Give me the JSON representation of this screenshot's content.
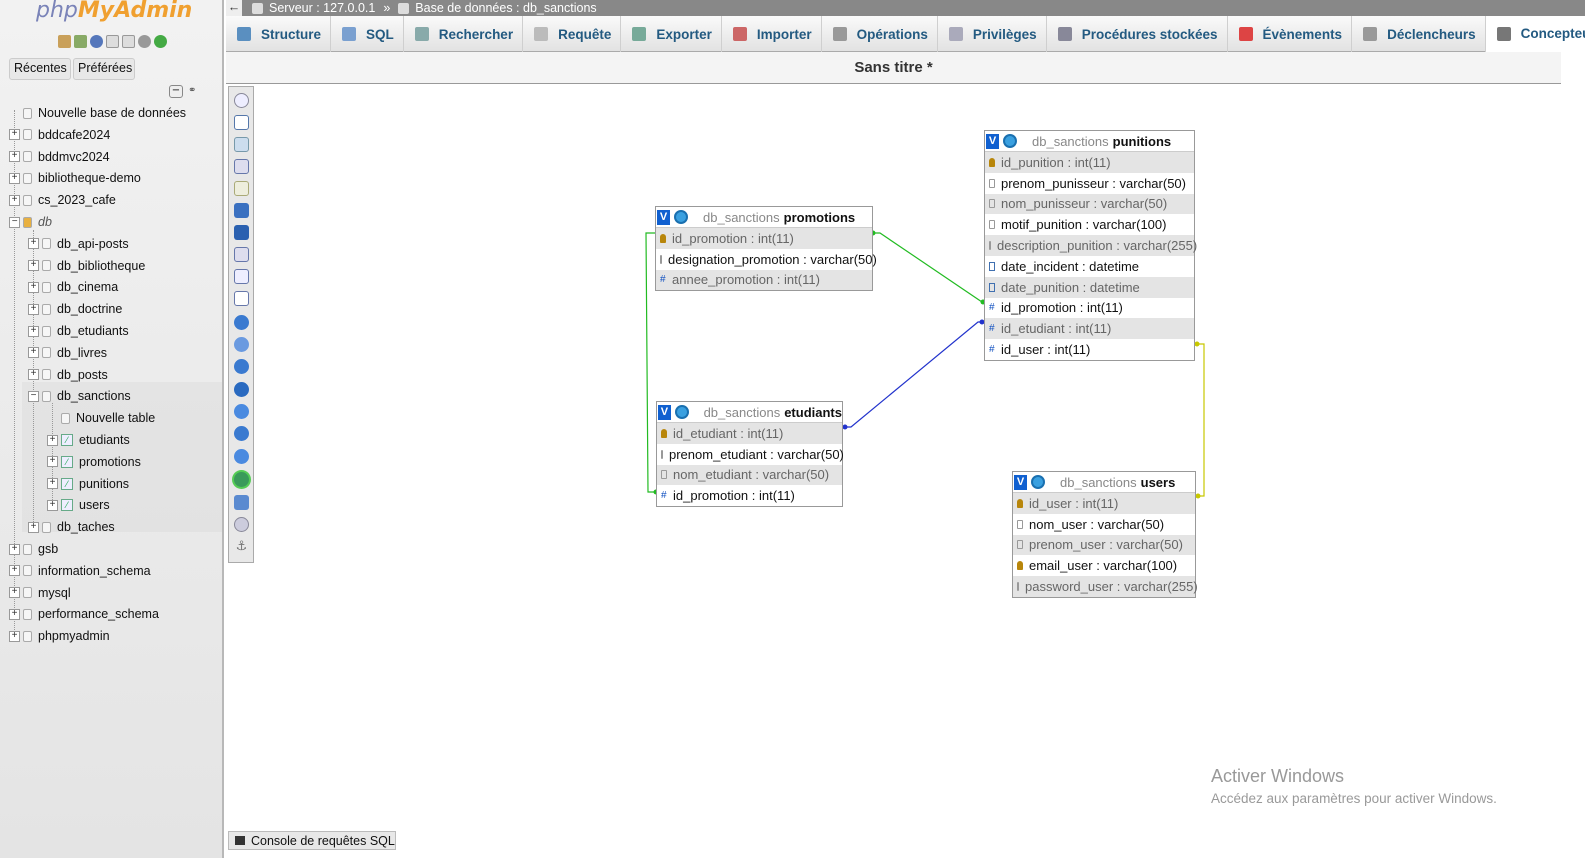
{
  "nav": {
    "logo_main": "php",
    "logo_accent": "MyAdmin",
    "tabs": [
      "Récentes",
      "Préférées"
    ],
    "tree": [
      {
        "label": "Nouvelle base de données",
        "level": 0,
        "expander": "",
        "icon": "new-db"
      },
      {
        "label": "bddcafe2024",
        "level": 0,
        "expander": "+",
        "icon": "db"
      },
      {
        "label": "bddmvc2024",
        "level": 0,
        "expander": "+",
        "icon": "db"
      },
      {
        "label": "bibliotheque-demo",
        "level": 0,
        "expander": "+",
        "icon": "db"
      },
      {
        "label": "cs_2023_cafe",
        "level": 0,
        "expander": "+",
        "icon": "db"
      },
      {
        "label": "db",
        "level": 0,
        "expander": "−",
        "icon": "db-group",
        "italic": true
      },
      {
        "label": "db_api-posts",
        "level": 1,
        "expander": "+",
        "icon": "db"
      },
      {
        "label": "db_bibliotheque",
        "level": 1,
        "expander": "+",
        "icon": "db"
      },
      {
        "label": "db_cinema",
        "level": 1,
        "expander": "+",
        "icon": "db"
      },
      {
        "label": "db_doctrine",
        "level": 1,
        "expander": "+",
        "icon": "db"
      },
      {
        "label": "db_etudiants",
        "level": 1,
        "expander": "+",
        "icon": "db"
      },
      {
        "label": "db_livres",
        "level": 1,
        "expander": "+",
        "icon": "db"
      },
      {
        "label": "db_posts",
        "level": 1,
        "expander": "+",
        "icon": "db"
      },
      {
        "label": "db_sanctions",
        "level": 1,
        "expander": "−",
        "icon": "db"
      },
      {
        "label": "Nouvelle table",
        "level": 2,
        "expander": "",
        "icon": "new-table"
      },
      {
        "label": "etudiants",
        "level": 2,
        "expander": "+",
        "icon": "table"
      },
      {
        "label": "promotions",
        "level": 2,
        "expander": "+",
        "icon": "table"
      },
      {
        "label": "punitions",
        "level": 2,
        "expander": "+",
        "icon": "table"
      },
      {
        "label": "users",
        "level": 2,
        "expander": "+",
        "icon": "table"
      },
      {
        "label": "db_taches",
        "level": 1,
        "expander": "+",
        "icon": "db"
      },
      {
        "label": "gsb",
        "level": 0,
        "expander": "+",
        "icon": "db"
      },
      {
        "label": "information_schema",
        "level": 0,
        "expander": "+",
        "icon": "db"
      },
      {
        "label": "mysql",
        "level": 0,
        "expander": "+",
        "icon": "db"
      },
      {
        "label": "performance_schema",
        "level": 0,
        "expander": "+",
        "icon": "db"
      },
      {
        "label": "phpmyadmin",
        "level": 0,
        "expander": "+",
        "icon": "db"
      }
    ]
  },
  "topbar": {
    "server": "Serveur : 127.0.0.1",
    "separator": "»",
    "database": "Base de données : db_sanctions"
  },
  "tabs": [
    {
      "label": "Structure",
      "icon": "structure-icon",
      "color": "#5a8fc0"
    },
    {
      "label": "SQL",
      "icon": "sql-icon",
      "color": "#7aa0d0"
    },
    {
      "label": "Rechercher",
      "icon": "search-icon",
      "color": "#8aa"
    },
    {
      "label": "Requête",
      "icon": "query-icon",
      "color": "#bbb"
    },
    {
      "label": "Exporter",
      "icon": "export-icon",
      "color": "#7a9"
    },
    {
      "label": "Importer",
      "icon": "import-icon",
      "color": "#c66"
    },
    {
      "label": "Opérations",
      "icon": "wrench-icon",
      "color": "#999"
    },
    {
      "label": "Privilèges",
      "icon": "privileges-icon",
      "color": "#aab"
    },
    {
      "label": "Procédures stockées",
      "icon": "routines-icon",
      "color": "#889"
    },
    {
      "label": "Évènements",
      "icon": "clock-icon",
      "color": "#d44"
    },
    {
      "label": "Déclencheurs",
      "icon": "triggers-icon",
      "color": "#999"
    },
    {
      "label": "Concepteur",
      "icon": "designer-icon",
      "color": "#777",
      "active": true
    }
  ],
  "designer": {
    "title": "Sans titre *",
    "tables": [
      {
        "id": "promotions",
        "db": "db_sanctions",
        "name": "promotions",
        "columns": [
          {
            "name": "id_promotion : int(11)",
            "kind": "key"
          },
          {
            "name": "designation_promotion : varchar(50)",
            "kind": "txt"
          },
          {
            "name": "annee_promotion : int(11)",
            "kind": "num"
          }
        ]
      },
      {
        "id": "punitions",
        "db": "db_sanctions",
        "name": "punitions",
        "columns": [
          {
            "name": "id_punition : int(11)",
            "kind": "key"
          },
          {
            "name": "prenom_punisseur : varchar(50)",
            "kind": "txt"
          },
          {
            "name": "nom_punisseur : varchar(50)",
            "kind": "txt"
          },
          {
            "name": "motif_punition : varchar(100)",
            "kind": "txt"
          },
          {
            "name": "description_punition : varchar(255)",
            "kind": "txt"
          },
          {
            "name": "date_incident : datetime",
            "kind": "dt"
          },
          {
            "name": "date_punition : datetime",
            "kind": "dt"
          },
          {
            "name": "id_promotion : int(11)",
            "kind": "num"
          },
          {
            "name": "id_etudiant : int(11)",
            "kind": "num"
          },
          {
            "name": "id_user : int(11)",
            "kind": "num"
          }
        ]
      },
      {
        "id": "etudiants",
        "db": "db_sanctions",
        "name": "etudiants",
        "columns": [
          {
            "name": "id_etudiant : int(11)",
            "kind": "key"
          },
          {
            "name": "prenom_etudiant : varchar(50)",
            "kind": "txt"
          },
          {
            "name": "nom_etudiant : varchar(50)",
            "kind": "txt"
          },
          {
            "name": "id_promotion : int(11)",
            "kind": "num"
          }
        ]
      },
      {
        "id": "users",
        "db": "db_sanctions",
        "name": "users",
        "columns": [
          {
            "name": "id_user : int(11)",
            "kind": "key"
          },
          {
            "name": "nom_user : varchar(50)",
            "kind": "txt"
          },
          {
            "name": "prenom_user : varchar(50)",
            "kind": "txt"
          },
          {
            "name": "email_user : varchar(100)",
            "kind": "key"
          },
          {
            "name": "password_user : varchar(255)",
            "kind": "txt"
          }
        ]
      }
    ],
    "relation_colors": {
      "promotion": "#22bb22",
      "etudiant": "#2233cc",
      "user": "#c8c800"
    }
  },
  "console": {
    "label": "Console de requêtes SQL"
  },
  "watermark": {
    "line1": "Activer Windows",
    "line2": "Accédez aux paramètres pour activer Windows."
  }
}
